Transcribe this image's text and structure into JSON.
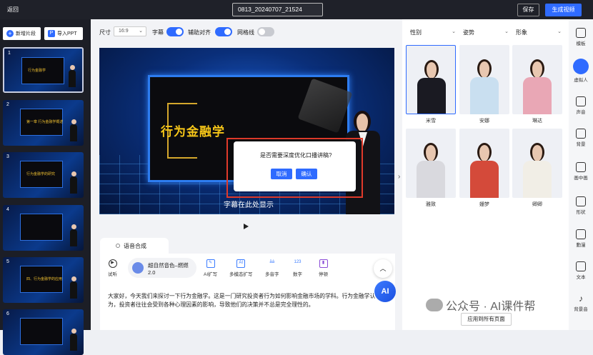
{
  "topbar": {
    "back": "返回",
    "project_name": "0813_20240707_21524",
    "save": "保存",
    "generate": "生成视频"
  },
  "left": {
    "add_slide": "新增片段",
    "import_ppt": "导入PPT",
    "slides": [
      {
        "num": "1",
        "title": "行为金融学"
      },
      {
        "num": "2",
        "title": "第一章 行为金融学概述"
      },
      {
        "num": "3",
        "title": "行为金融学的研究"
      },
      {
        "num": "4",
        "title": ""
      },
      {
        "num": "5",
        "title": "四、行为金融学的应用"
      },
      {
        "num": "6",
        "title": ""
      }
    ]
  },
  "toolbar_mid": {
    "size_label": "尺寸",
    "ratio": "16:9",
    "subtitle": "字幕",
    "align": "辅助对齐",
    "grid": "网格线"
  },
  "canvas": {
    "slide_title": "行为金融学",
    "subtitle_placeholder": "字幕在此处显示"
  },
  "dialog": {
    "message": "是否需要深度优化口播讲稿?",
    "cancel": "取消",
    "confirm": "确认"
  },
  "voice": {
    "tab": "语音合成",
    "trial": "试听",
    "voice_name": "超自然音色–燃燃",
    "voice_version": "2.0",
    "tools": {
      "ai_rewrite": "AI扩写",
      "multimodal": "多模态扩写",
      "polyphone": "多音字",
      "digits": "数字",
      "pause": "停顿"
    },
    "script": "大家好，今天我们来探讨一下行为金融学。这是一门研究投资者行为如何影响金融市场的学科。行为金融学认为，投资者往往会受到各种心理因素的影响，导致他们的决策并不总是完全理性的。",
    "ai": "AI"
  },
  "filters": {
    "gender": "性别",
    "pose": "姿势",
    "image": "形象"
  },
  "avatars": [
    {
      "name": "米雪",
      "outfit": "#1a1a22"
    },
    {
      "name": "安娜",
      "outfit": "#c9dff0"
    },
    {
      "name": "琳达",
      "outfit": "#e9a7b5"
    },
    {
      "name": "雅致",
      "outfit": "#d9d9de"
    },
    {
      "name": "姗梦",
      "outfit": "#d44a3a"
    },
    {
      "name": "卿卿",
      "outfit": "#f1eee6"
    }
  ],
  "apply_all": "应用到所有页面",
  "right_tools": {
    "template": "模板",
    "avatar": "虚拟人",
    "audio": "声音",
    "background": "背景",
    "pip": "画中画",
    "shape": "形状",
    "animation": "動漫",
    "text": "文本",
    "bgm": "背景音"
  },
  "watermark": "公众号 · AI课件帮"
}
